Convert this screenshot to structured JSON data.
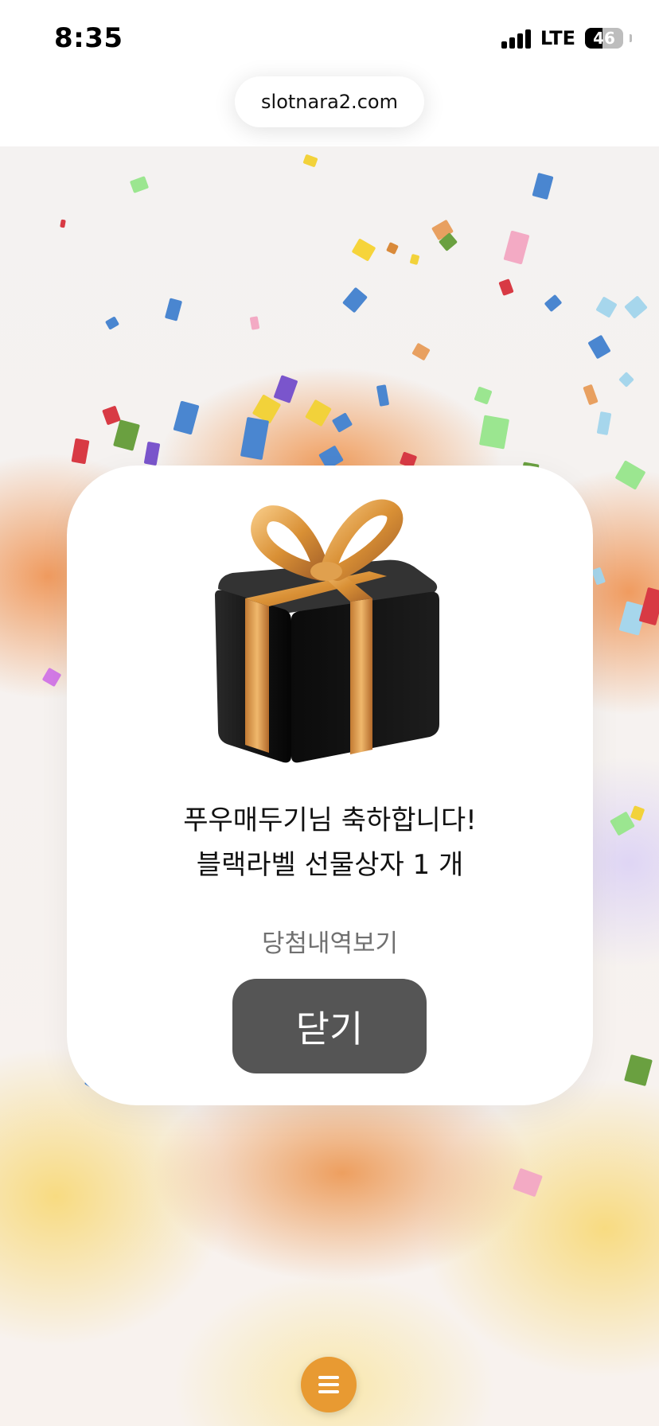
{
  "status_bar": {
    "time": "8:35",
    "network": "LTE",
    "battery_level": 46,
    "battery_label": "46"
  },
  "browser": {
    "url": "slotnara2.com"
  },
  "modal": {
    "icon": "gift-box-icon",
    "line1": "푸우매두기님 축하합니다!",
    "line2": "블랙라벨 선물상자 1 개",
    "history_link": "당첨내역보기",
    "close_button": "닫기"
  },
  "menu": {
    "icon": "hamburger-menu-icon",
    "color": "#e89a32"
  },
  "colors": {
    "close_button_bg": "#555555",
    "ribbon_gold": "#d9903a",
    "box_black": "#161616"
  }
}
